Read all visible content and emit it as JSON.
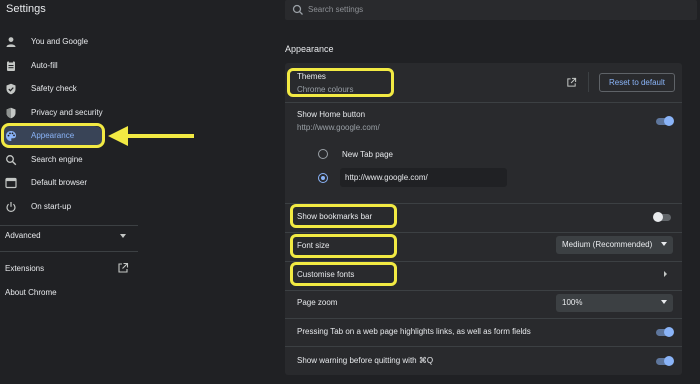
{
  "app": {
    "title": "Settings"
  },
  "search": {
    "placeholder": "Search settings"
  },
  "sidebar": {
    "items": [
      {
        "label": "You and Google",
        "icon": "person-icon"
      },
      {
        "label": "Auto-fill",
        "icon": "clipboard-icon"
      },
      {
        "label": "Safety check",
        "icon": "shield-check-icon"
      },
      {
        "label": "Privacy and security",
        "icon": "shield-icon"
      },
      {
        "label": "Appearance",
        "icon": "palette-icon"
      },
      {
        "label": "Search engine",
        "icon": "search-icon"
      },
      {
        "label": "Default browser",
        "icon": "browser-icon"
      },
      {
        "label": "On start-up",
        "icon": "power-icon"
      }
    ],
    "advanced": "Advanced",
    "extensions": "Extensions",
    "about": "About Chrome"
  },
  "main": {
    "section_title": "Appearance",
    "themes": {
      "label": "Themes",
      "sub": "Chrome colours",
      "reset": "Reset to default"
    },
    "home_button": {
      "label": "Show Home button",
      "sub": "http://www.google.com/",
      "enabled": true,
      "options": [
        "New Tab page",
        "http://www.google.com/"
      ],
      "selected": 1,
      "custom_url": "http://www.google.com/"
    },
    "bookmarks_bar": {
      "label": "Show bookmarks bar",
      "enabled": false
    },
    "font_size": {
      "label": "Font size",
      "value": "Medium (Recommended)"
    },
    "customise_fonts": {
      "label": "Customise fonts"
    },
    "page_zoom": {
      "label": "Page zoom",
      "value": "100%"
    },
    "tab_highlight": {
      "label": "Pressing Tab on a web page highlights links, as well as form fields",
      "enabled": true
    },
    "quit_warning": {
      "label": "Show warning before quitting with ⌘Q",
      "enabled": true
    }
  },
  "colors": {
    "accent": "#8ab4f8",
    "highlight": "#f2ea43",
    "background": "#202124",
    "card": "#292a2d"
  }
}
